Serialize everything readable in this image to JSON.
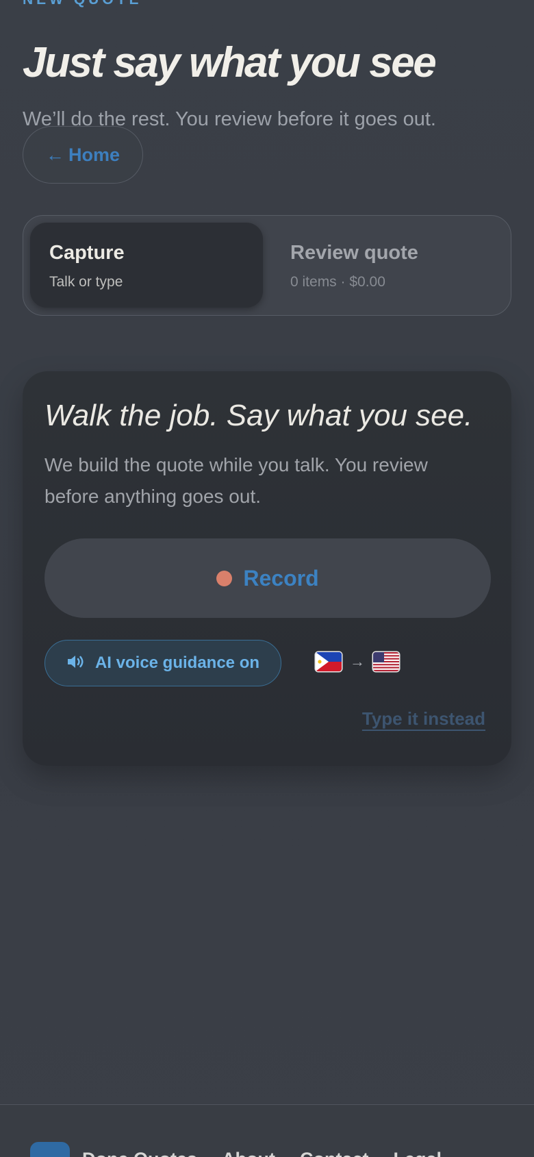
{
  "header": {
    "eyebrow": "NEW QUOTE",
    "title": "Just say what you see",
    "subtitle": "We’ll do the rest. You review before it goes out."
  },
  "nav": {
    "home_arrow": "←",
    "home_label": "Home"
  },
  "steps": [
    {
      "title": "Capture",
      "subtitle": "Talk or type",
      "active": true
    },
    {
      "title": "Review quote",
      "subtitle": "0 items · $0.00",
      "active": false
    }
  ],
  "capture_card": {
    "title": "Walk the job. Say what you see.",
    "description": "We build the quote while you talk. You review before anything goes out.",
    "record_label": "Record",
    "record_dot_color": "#d9806b",
    "voice_guidance_label": "AI voice guidance on",
    "voice_icon": "speaker-icon",
    "language_from_icon": "philippines-flag-icon",
    "language_arrow": "→",
    "language_to_icon": "us-flag-icon",
    "type_instead_label": "Type it instead"
  },
  "footer": {
    "logo_icon": "app-logo-icon",
    "links": [
      "Done Quotes",
      "About",
      "Contact",
      "Legal"
    ]
  },
  "colors": {
    "accent": "#3c82c2",
    "accent_light": "#6bb3e8",
    "background": "#3a3f47",
    "card": "#2c2f35"
  }
}
